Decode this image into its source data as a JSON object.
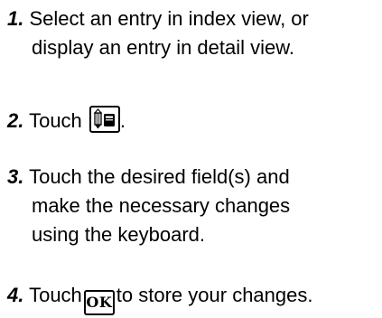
{
  "steps": [
    {
      "number": "1.",
      "lines": [
        "Select an entry in index view, or",
        "display an entry in detail view."
      ]
    },
    {
      "number": "2.",
      "before": "Touch",
      "icon": "edit-icon",
      "after": "."
    },
    {
      "number": "3.",
      "lines": [
        "Touch the desired field(s) and",
        "make the necessary changes",
        "using the keyboard."
      ]
    },
    {
      "number": "4.",
      "before": "Touch",
      "icon": "ok-icon",
      "icon_label": "OK",
      "after": "to store your changes."
    }
  ]
}
